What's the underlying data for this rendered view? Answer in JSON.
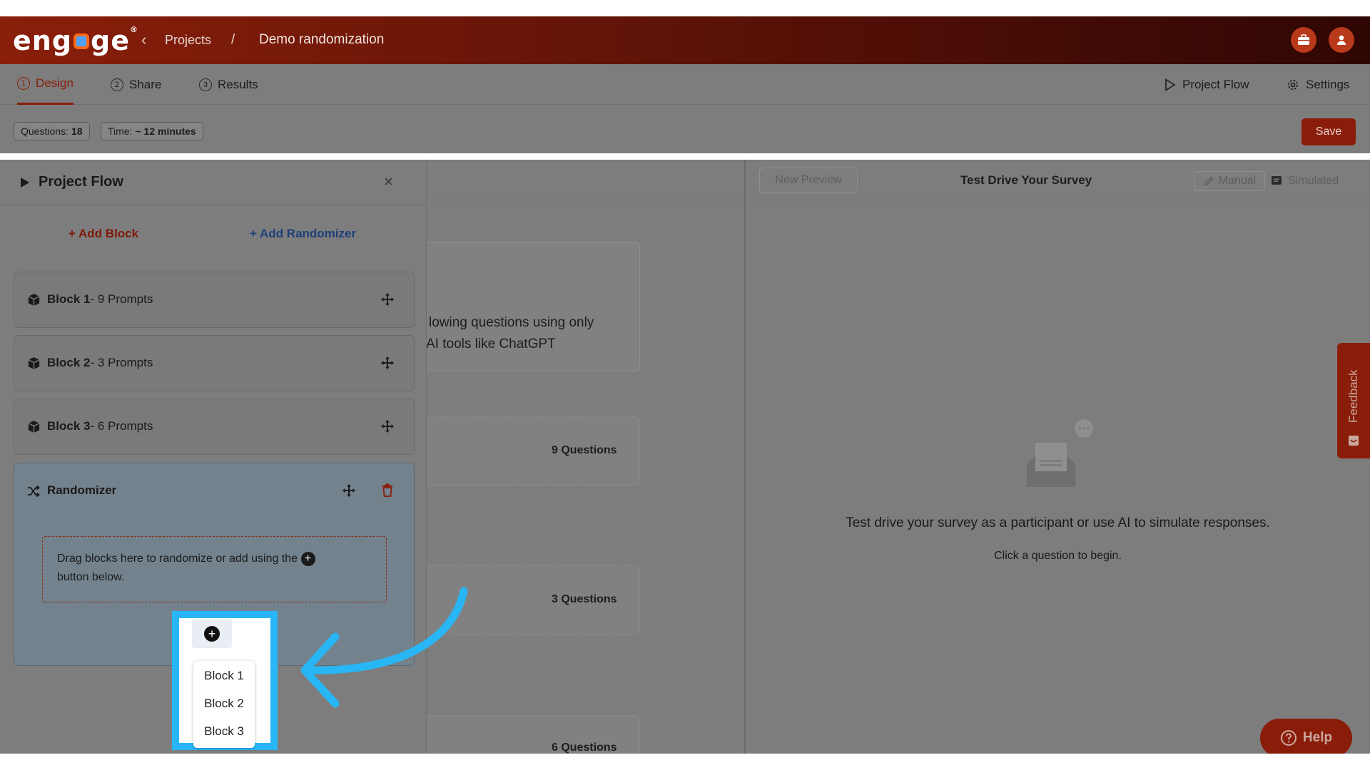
{
  "header": {
    "logo": "engage",
    "breadcrumb_back": "‹",
    "breadcrumb_projects": "Projects",
    "breadcrumb_sep": "/",
    "project_title": "Demo randomization"
  },
  "tabs": [
    {
      "num": "1",
      "label": "Design",
      "active": true
    },
    {
      "num": "2",
      "label": "Share",
      "active": false
    },
    {
      "num": "3",
      "label": "Results",
      "active": false
    }
  ],
  "right_links": {
    "project_flow": "Project Flow",
    "settings": "Settings"
  },
  "info": {
    "questions_label": "Questions:",
    "questions_value": "18",
    "time_label": "Time:",
    "time_value": "~ 12 minutes",
    "save_label": "Save"
  },
  "center": {
    "card_text_line1": "lowing questions using only",
    "card_text_line2": "AI tools like ChatGPT",
    "q1": "9 Questions",
    "q2": "3 Questions",
    "q3": "6 Questions"
  },
  "preview": {
    "new_preview": "New Preview",
    "title": "Test Drive Your Survey",
    "manual": "Manual",
    "simulated": "Simulated",
    "empty_text": "Test drive your survey as a participant or use AI to simulate responses.",
    "empty_sub": "Click a question to begin.",
    "feedback": "Feedback",
    "help": "Help"
  },
  "panel": {
    "title": "Project Flow",
    "close": "×",
    "add_block": "Add Block",
    "add_randomizer": "Add Randomizer",
    "blocks": [
      {
        "name": "Block 1",
        "detail": "- 9 Prompts"
      },
      {
        "name": "Block 2",
        "detail": "- 3 Prompts"
      },
      {
        "name": "Block 3",
        "detail": "- 6 Prompts"
      }
    ],
    "randomizer_title": "Randomizer",
    "randomizer_hint_1": "Drag blocks here to randomize or add using the",
    "randomizer_hint_2": "button below."
  },
  "popup": {
    "menu": [
      "Block 1",
      "Block 2",
      "Block 3"
    ]
  },
  "colors": {
    "brand": "#8a1d0a",
    "highlight": "#29b6f6",
    "randomizer_link": "#1e3f78"
  }
}
